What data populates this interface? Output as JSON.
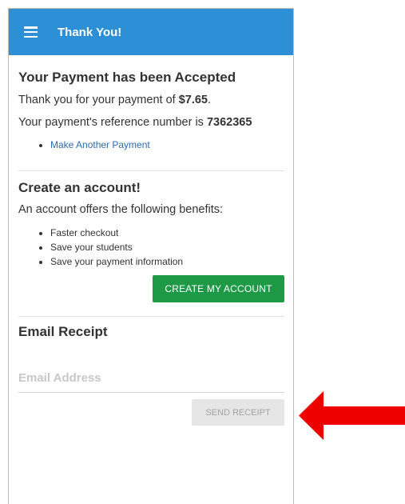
{
  "appbar": {
    "menu_icon": "hamburger-menu-icon",
    "title": "Thank You!",
    "color": "#2d8fd5"
  },
  "payment": {
    "heading": "Your Payment has been Accepted",
    "thanks_prefix": "Thank you for your payment of ",
    "amount": "$7.65",
    "thanks_suffix": ".",
    "reference_prefix": "Your payment's reference number is ",
    "reference_number": "7362365",
    "link_label": "Make Another Payment"
  },
  "account": {
    "heading": "Create an account!",
    "intro": "An account offers the following benefits:",
    "benefits": [
      "Faster checkout",
      "Save your students",
      "Save your payment information"
    ],
    "button_label": "CREATE MY ACCOUNT",
    "button_color": "#1e9a47"
  },
  "receipt": {
    "heading": "Email Receipt",
    "email_placeholder": "Email Address",
    "email_value": "",
    "button_label": "SEND RECEIPT",
    "button_state": "disabled"
  },
  "annotation": {
    "arrow_icon": "red-arrow-icon",
    "arrow_color": "#ee0000"
  }
}
